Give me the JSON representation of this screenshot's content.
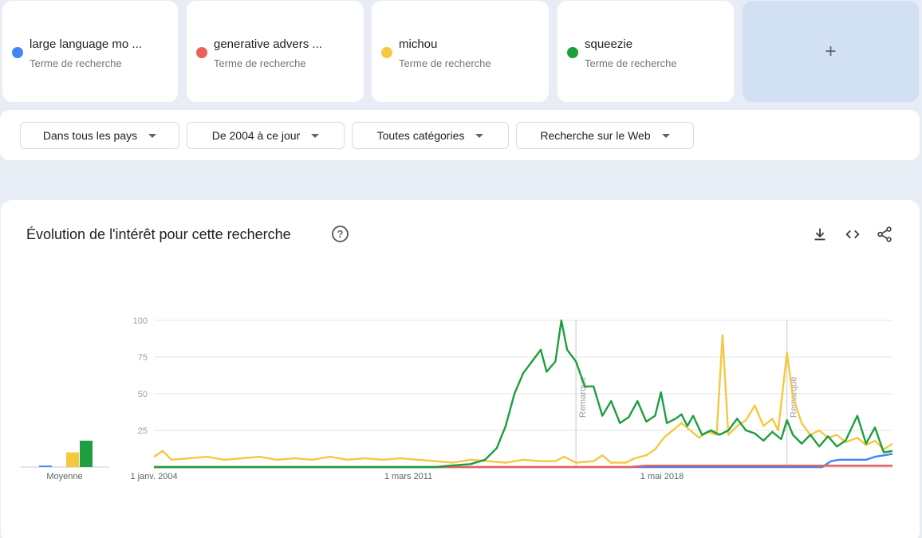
{
  "terms": [
    {
      "name": "large language mo ...",
      "type": "Terme de recherche",
      "color": "#4285f4"
    },
    {
      "name": "generative advers ...",
      "type": "Terme de recherche",
      "color": "#e8615a"
    },
    {
      "name": "michou",
      "type": "Terme de recherche",
      "color": "#f5c842"
    },
    {
      "name": "squeezie",
      "type": "Terme de recherche",
      "color": "#1e9e3e"
    }
  ],
  "add_label": "+",
  "filters": {
    "region": "Dans tous les pays",
    "period": "De 2004 à ce jour",
    "category": "Toutes catégories",
    "search_type": "Recherche sur le Web"
  },
  "chart": {
    "title": "Évolution de l'intérêt pour cette recherche",
    "help": "?",
    "icons": [
      "download-icon",
      "embed-code-icon",
      "share-icon"
    ]
  },
  "chart_data": {
    "type": "line",
    "ylim": [
      0,
      100
    ],
    "yticks": [
      100,
      75,
      50,
      25
    ],
    "xticks": [
      "1 janv. 2004",
      "1 mars 2011",
      "1 mai 2018"
    ],
    "xrange": [
      "2004-01",
      "2025-01"
    ],
    "grid": true,
    "legend": "top",
    "annotations": [
      {
        "label": "Remarque",
        "date": "2016-01"
      },
      {
        "label": "Remarque",
        "date": "2022-01"
      }
    ],
    "average": {
      "label": "Moyenne",
      "values": {
        "large language mo ...": 1,
        "generative advers ...": 0,
        "michou": 10,
        "squeezie": 18
      }
    },
    "series": [
      {
        "name": "large language mo ...",
        "color": "#4285f4",
        "points": [
          [
            "2004-01",
            0
          ],
          [
            "2023-01",
            0
          ],
          [
            "2023-04",
            4
          ],
          [
            "2023-07",
            5
          ],
          [
            "2024-01",
            5
          ],
          [
            "2024-04",
            5
          ],
          [
            "2024-07",
            7
          ],
          [
            "2024-10",
            8
          ],
          [
            "2025-01",
            9
          ]
        ]
      },
      {
        "name": "generative advers ...",
        "color": "#e8615a",
        "points": [
          [
            "2004-01",
            0
          ],
          [
            "2017-07",
            0
          ],
          [
            "2018-01",
            1
          ],
          [
            "2020-01",
            1
          ],
          [
            "2022-01",
            1
          ],
          [
            "2025-01",
            1
          ]
        ]
      },
      {
        "name": "michou",
        "color": "#f5c842",
        "points": [
          [
            "2004-01",
            7
          ],
          [
            "2004-04",
            11
          ],
          [
            "2004-07",
            5
          ],
          [
            "2005-01",
            6
          ],
          [
            "2005-07",
            7
          ],
          [
            "2006-01",
            5
          ],
          [
            "2006-07",
            6
          ],
          [
            "2007-01",
            7
          ],
          [
            "2007-07",
            5
          ],
          [
            "2008-01",
            6
          ],
          [
            "2008-07",
            5
          ],
          [
            "2009-01",
            7
          ],
          [
            "2009-07",
            5
          ],
          [
            "2010-01",
            6
          ],
          [
            "2010-07",
            5
          ],
          [
            "2011-01",
            6
          ],
          [
            "2011-07",
            5
          ],
          [
            "2012-01",
            4
          ],
          [
            "2012-07",
            3
          ],
          [
            "2013-01",
            5
          ],
          [
            "2013-07",
            4
          ],
          [
            "2014-01",
            3
          ],
          [
            "2014-07",
            5
          ],
          [
            "2015-01",
            4
          ],
          [
            "2015-06",
            4
          ],
          [
            "2015-09",
            7
          ],
          [
            "2016-01",
            3
          ],
          [
            "2016-07",
            4
          ],
          [
            "2016-10",
            8
          ],
          [
            "2017-01",
            3
          ],
          [
            "2017-06",
            3
          ],
          [
            "2017-09",
            6
          ],
          [
            "2018-01",
            8
          ],
          [
            "2018-04",
            12
          ],
          [
            "2018-07",
            20
          ],
          [
            "2018-10",
            25
          ],
          [
            "2019-01",
            30
          ],
          [
            "2019-04",
            25
          ],
          [
            "2019-07",
            20
          ],
          [
            "2019-10",
            24
          ],
          [
            "2020-01",
            22
          ],
          [
            "2020-03",
            90
          ],
          [
            "2020-05",
            22
          ],
          [
            "2020-08",
            28
          ],
          [
            "2020-11",
            32
          ],
          [
            "2021-02",
            42
          ],
          [
            "2021-05",
            28
          ],
          [
            "2021-08",
            33
          ],
          [
            "2021-10",
            25
          ],
          [
            "2022-01",
            78
          ],
          [
            "2022-03",
            48
          ],
          [
            "2022-06",
            30
          ],
          [
            "2022-09",
            22
          ],
          [
            "2022-12",
            25
          ],
          [
            "2023-03",
            20
          ],
          [
            "2023-06",
            22
          ],
          [
            "2023-09",
            17
          ],
          [
            "2024-01",
            20
          ],
          [
            "2024-04",
            15
          ],
          [
            "2024-07",
            18
          ],
          [
            "2024-10",
            12
          ],
          [
            "2025-01",
            16
          ]
        ]
      },
      {
        "name": "squeezie",
        "color": "#1e9e3e",
        "points": [
          [
            "2004-01",
            0
          ],
          [
            "2012-01",
            0
          ],
          [
            "2012-06",
            1
          ],
          [
            "2013-01",
            2
          ],
          [
            "2013-06",
            5
          ],
          [
            "2013-10",
            13
          ],
          [
            "2014-01",
            28
          ],
          [
            "2014-04",
            50
          ],
          [
            "2014-07",
            64
          ],
          [
            "2014-10",
            72
          ],
          [
            "2015-01",
            80
          ],
          [
            "2015-03",
            65
          ],
          [
            "2015-06",
            72
          ],
          [
            "2015-08",
            100
          ],
          [
            "2015-10",
            80
          ],
          [
            "2016-01",
            72
          ],
          [
            "2016-04",
            55
          ],
          [
            "2016-07",
            55
          ],
          [
            "2016-10",
            35
          ],
          [
            "2017-01",
            45
          ],
          [
            "2017-04",
            30
          ],
          [
            "2017-07",
            34
          ],
          [
            "2017-10",
            45
          ],
          [
            "2018-01",
            31
          ],
          [
            "2018-04",
            35
          ],
          [
            "2018-06",
            51
          ],
          [
            "2018-08",
            30
          ],
          [
            "2018-11",
            33
          ],
          [
            "2019-01",
            36
          ],
          [
            "2019-03",
            28
          ],
          [
            "2019-05",
            35
          ],
          [
            "2019-08",
            22
          ],
          [
            "2019-11",
            25
          ],
          [
            "2020-02",
            22
          ],
          [
            "2020-05",
            25
          ],
          [
            "2020-08",
            33
          ],
          [
            "2020-11",
            25
          ],
          [
            "2021-02",
            23
          ],
          [
            "2021-05",
            18
          ],
          [
            "2021-08",
            24
          ],
          [
            "2021-11",
            19
          ],
          [
            "2022-01",
            32
          ],
          [
            "2022-03",
            22
          ],
          [
            "2022-06",
            16
          ],
          [
            "2022-09",
            22
          ],
          [
            "2022-12",
            14
          ],
          [
            "2023-03",
            21
          ],
          [
            "2023-06",
            14
          ],
          [
            "2023-09",
            18
          ],
          [
            "2024-01",
            35
          ],
          [
            "2024-04",
            16
          ],
          [
            "2024-07",
            27
          ],
          [
            "2024-10",
            10
          ],
          [
            "2025-01",
            11
          ]
        ]
      }
    ]
  }
}
